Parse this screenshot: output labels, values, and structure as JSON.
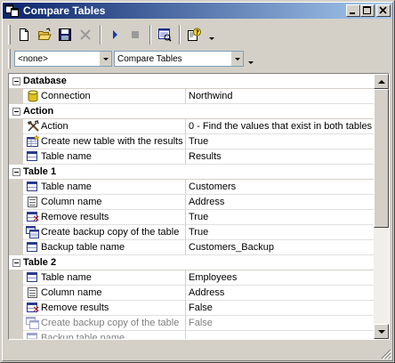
{
  "window": {
    "title": "Compare Tables"
  },
  "toolbar": {
    "buttons": [
      "new-icon",
      "open-icon",
      "save-icon",
      "delete-icon",
      "run-icon",
      "stop-icon",
      "preview-icon",
      "help-icon"
    ]
  },
  "toolbar2": {
    "combo1": {
      "value": "<none>"
    },
    "combo2": {
      "value": "Compare Tables"
    }
  },
  "grid": {
    "database": {
      "label": "Database",
      "connection": {
        "name": "Connection",
        "value": "Northwind"
      }
    },
    "action": {
      "label": "Action",
      "action": {
        "name": "Action",
        "value": "0 - Find the values that exist in both tables"
      },
      "create_new": {
        "name": "Create new table with the results",
        "value": "True"
      },
      "table_name": {
        "name": "Table name",
        "value": "Results"
      }
    },
    "table1": {
      "label": "Table 1",
      "table_name": {
        "name": "Table name",
        "value": "Customers"
      },
      "column_name": {
        "name": "Column name",
        "value": "Address"
      },
      "remove_results": {
        "name": "Remove results",
        "value": "True"
      },
      "create_backup": {
        "name": "Create backup copy of the table",
        "value": "True"
      },
      "backup_name": {
        "name": "Backup table name",
        "value": "Customers_Backup"
      }
    },
    "table2": {
      "label": "Table 2",
      "table_name": {
        "name": "Table name",
        "value": "Employees"
      },
      "column_name": {
        "name": "Column name",
        "value": "Address"
      },
      "remove_results": {
        "name": "Remove results",
        "value": "False"
      },
      "create_backup": {
        "name": "Create backup copy of the table",
        "value": "False"
      },
      "backup_name": {
        "name": "Backup table name",
        "value": ""
      }
    }
  },
  "colors": {
    "title_gradient_start": "#0a246a",
    "title_gradient_end": "#a6caf0",
    "face": "#d4d0c8",
    "disabled_text": "#808080"
  }
}
